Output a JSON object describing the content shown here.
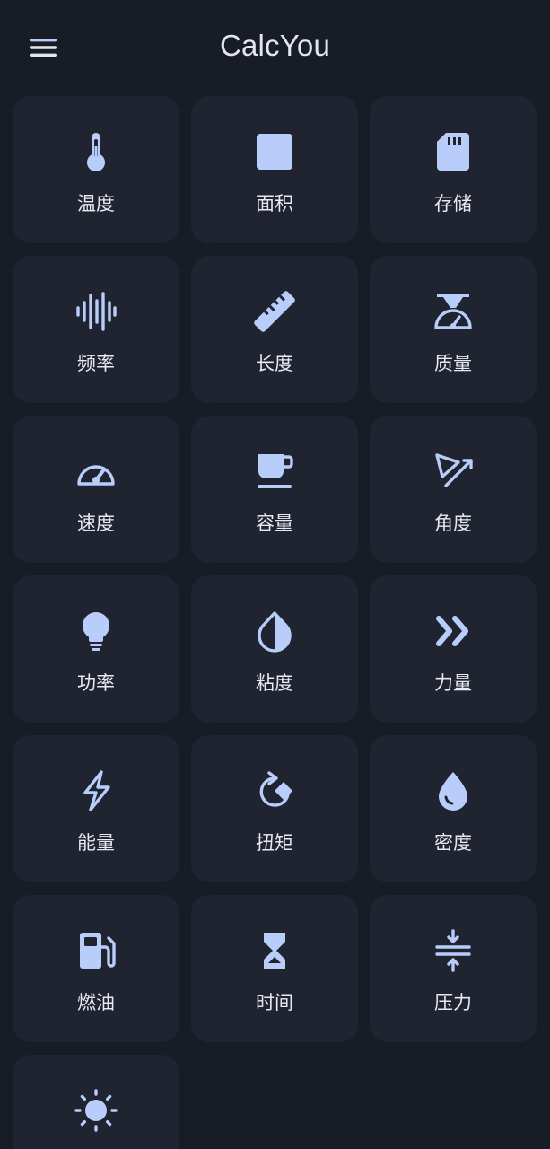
{
  "app": {
    "title": "CalcYou",
    "menu_icon": "hamburger-menu-icon"
  },
  "colors": {
    "background": "#181c24",
    "tile": "#1f2430",
    "icon": "#b9cdfa",
    "text": "#e8eaf0"
  },
  "tiles": [
    {
      "label": "温度",
      "icon": "thermometer-icon"
    },
    {
      "label": "面积",
      "icon": "square-icon"
    },
    {
      "label": "存储",
      "icon": "sd-card-icon"
    },
    {
      "label": "频率",
      "icon": "waveform-icon"
    },
    {
      "label": "长度",
      "icon": "ruler-icon"
    },
    {
      "label": "质量",
      "icon": "scale-icon"
    },
    {
      "label": "速度",
      "icon": "speedometer-icon"
    },
    {
      "label": "容量",
      "icon": "coffee-cup-icon"
    },
    {
      "label": "角度",
      "icon": "angle-icon"
    },
    {
      "label": "功率",
      "icon": "lightbulb-icon"
    },
    {
      "label": "粘度",
      "icon": "contrast-drop-icon"
    },
    {
      "label": "力量",
      "icon": "double-chevron-right-icon"
    },
    {
      "label": "能量",
      "icon": "lightning-bolt-icon"
    },
    {
      "label": "扭矩",
      "icon": "rotate-right-icon"
    },
    {
      "label": "密度",
      "icon": "water-drop-icon"
    },
    {
      "label": "燃油",
      "icon": "fuel-pump-icon"
    },
    {
      "label": "时间",
      "icon": "hourglass-icon"
    },
    {
      "label": "压力",
      "icon": "compress-icon"
    },
    {
      "label": "",
      "icon": "sun-icon"
    }
  ]
}
